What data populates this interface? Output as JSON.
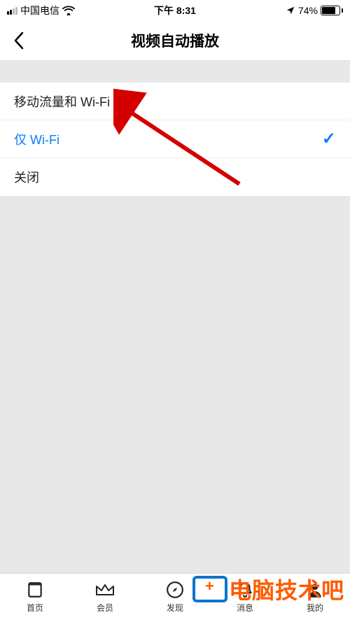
{
  "statusBar": {
    "carrier": "中国电信",
    "time": "下午 8:31",
    "battery": "74%"
  },
  "header": {
    "title": "视频自动播放"
  },
  "options": [
    {
      "label": "移动流量和 Wi-Fi",
      "selected": false
    },
    {
      "label": "仅 Wi-Fi",
      "selected": true
    },
    {
      "label": "关闭",
      "selected": false
    }
  ],
  "tabs": [
    {
      "label": "首页"
    },
    {
      "label": "会员"
    },
    {
      "label": "发现"
    },
    {
      "label": "消息"
    },
    {
      "label": "我的"
    }
  ],
  "watermark": "电脑技术吧"
}
